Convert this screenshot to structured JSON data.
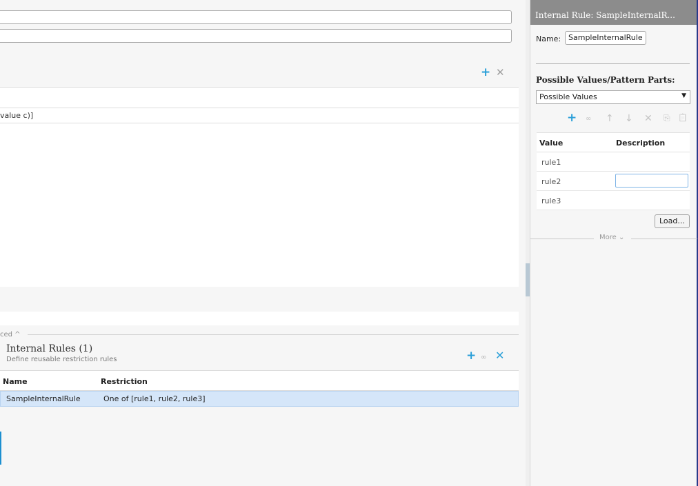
{
  "main": {
    "possible_values_row": "value c)]",
    "advanced_label": "ced ^",
    "internal_rules": {
      "title": "Internal Rules (1)",
      "subtitle": "Define reusable restriction rules",
      "columns": [
        "Name",
        "Restriction"
      ],
      "rows": [
        {
          "name": "SampleInternalRule",
          "restriction": "One of [rule1, rule2, rule3]"
        }
      ]
    },
    "icons": {
      "add": "+",
      "delete": "✕",
      "link": "∞"
    }
  },
  "right_panel": {
    "title": "Internal Rule: SampleInternalR...",
    "name_label": "Name:",
    "name_value": "SampleInternalRule",
    "pv_label": "Possible Values/Pattern Parts:",
    "pv_select": "Possible Values",
    "toolbar": {
      "add": "+",
      "link": "∞",
      "up": "↑",
      "down": "↓",
      "delete": "✕",
      "copy": "⎘",
      "paste": "📋"
    },
    "columns": [
      "Value",
      "Description"
    ],
    "rows": [
      {
        "value": "rule1",
        "description": ""
      },
      {
        "value": "rule2",
        "description": ""
      },
      {
        "value": "rule3",
        "description": ""
      }
    ],
    "load_button": "Load...",
    "more_label": "More ⌄"
  },
  "colors": {
    "accent": "#2a9fd8",
    "title_bar": "#8c8c8c",
    "selected_row": "#d5e6f9"
  }
}
